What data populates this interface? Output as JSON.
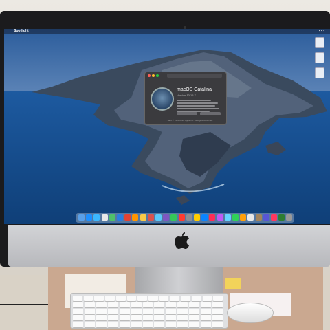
{
  "menubar": {
    "app_name": "Spotlight"
  },
  "about_window": {
    "os_name": "macOS Catalina",
    "version": "Version 10.15.7",
    "footer": "™ and © 1983-2020 Apple Inc. All Rights Reserved."
  },
  "dock": {
    "icon_colors": [
      "#5aa0e8",
      "#1e90ff",
      "#3cb8ff",
      "#e8e8e8",
      "#4fc06a",
      "#2a7de1",
      "#e34234",
      "#ff9500",
      "#f7c948",
      "#d9534f",
      "#5ac8fa",
      "#7e57c2",
      "#34c759",
      "#ff3b30",
      "#8e8e93",
      "#ffcc00",
      "#0a84ff",
      "#ff2d55",
      "#bf5af2",
      "#64d2ff",
      "#30d158",
      "#ff9f0a",
      "#e8e8e8",
      "#a2845e",
      "#5856d6",
      "#ff375f",
      "#2e7d32",
      "#999999"
    ]
  },
  "hardware": {
    "brand_logo": "apple-logo"
  }
}
